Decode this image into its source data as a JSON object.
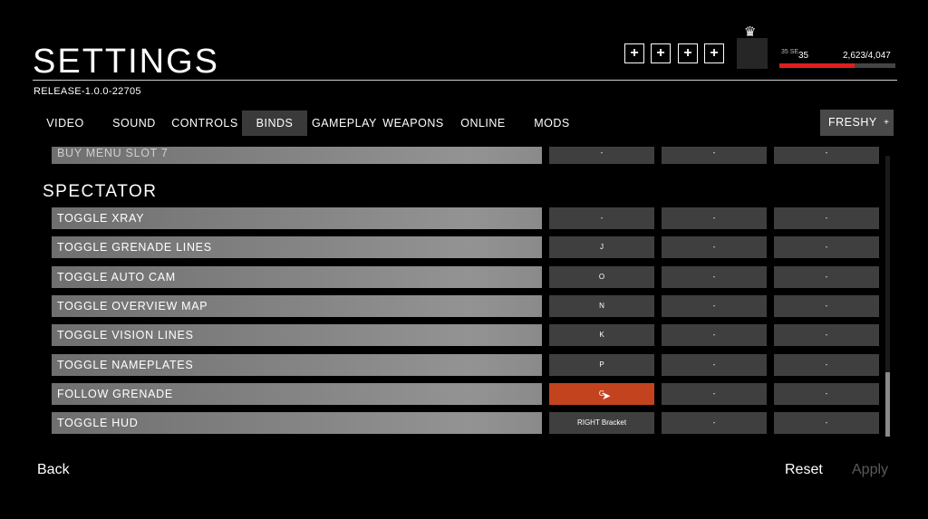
{
  "header": {
    "title": "SETTINGS",
    "version": "RELEASE-1.0.0-22705",
    "plus_buttons": [
      "+",
      "+",
      "+",
      "+"
    ],
    "crown_icon": "crown-icon",
    "rank_icon_text": "35 SE",
    "level": "35",
    "xp_text": "2,623/4,047",
    "xp_progress": 0.648,
    "xp_color": "#e01e1e"
  },
  "tabs": [
    {
      "label": "VIDEO"
    },
    {
      "label": "SOUND"
    },
    {
      "label": "CONTROLS"
    },
    {
      "label": "BINDS",
      "active": true
    },
    {
      "label": "GAMEPLAY"
    },
    {
      "label": "WEAPONS"
    },
    {
      "label": "ONLINE"
    },
    {
      "label": "MODS"
    }
  ],
  "profile": {
    "name": "FRESHY",
    "plus": "+"
  },
  "partial_row": {
    "label": "BUY MENU SLOT 7",
    "keys": [
      "-",
      "-",
      "-"
    ]
  },
  "section": {
    "title": "SPECTATOR"
  },
  "rows": [
    {
      "label": "TOGGLE XRAY",
      "keys": [
        "-",
        "-",
        "-"
      ]
    },
    {
      "label": "TOGGLE GRENADE LINES",
      "keys": [
        "J",
        "-",
        "-"
      ]
    },
    {
      "label": "TOGGLE AUTO CAM",
      "keys": [
        "O",
        "-",
        "-"
      ]
    },
    {
      "label": "TOGGLE OVERVIEW MAP",
      "keys": [
        "N",
        "-",
        "-"
      ]
    },
    {
      "label": "TOGGLE VISION LINES",
      "keys": [
        "K",
        "-",
        "-"
      ]
    },
    {
      "label": "TOGGLE NAMEPLATES",
      "keys": [
        "P",
        "-",
        "-"
      ]
    },
    {
      "label": "FOLLOW GRENADE",
      "keys": [
        "G",
        "-",
        "-"
      ],
      "selected": true
    },
    {
      "label": "TOGGLE HUD",
      "keys": [
        "RIGHT Bracket",
        "-",
        "-"
      ]
    }
  ],
  "footer": {
    "back": "Back",
    "reset": "Reset",
    "apply": "Apply"
  },
  "colors": {
    "selected_key": "#c4431f",
    "apply_disabled": "#5a5a5a"
  }
}
